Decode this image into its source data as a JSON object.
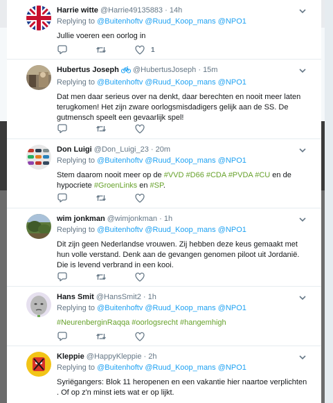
{
  "reply_prefix": "Replying to",
  "tweets": [
    {
      "name": "Harrie witte",
      "handle": "@Harrie49135883",
      "time": "14h",
      "replying_to": [
        "@Buitenhoftv",
        "@Ruud_Koop_mans",
        "@NPO1"
      ],
      "text": "Jullie voeren een oorlog in",
      "like_count": "1",
      "avatar": "union-jack-avatar"
    },
    {
      "name": "Hubertus Joseph",
      "name_suffix_icon": "bicycle-icon",
      "handle": "@HubertusJoseph",
      "time": "15m",
      "replying_to": [
        "@Buitenhoftv",
        "@Ruud_Koop_mans",
        "@NPO1"
      ],
      "text": "Dat men daar serieus over na denkt, daar berechten en nooit meer laten terugkomen! Het zijn zware oorlogsmisdadigers gelijk aan de SS. De gutmensch speelt een gevaarlijk spel!",
      "avatar": "photo-avatar"
    },
    {
      "name": "Don Luigi",
      "handle": "@Don_Luigi_23",
      "time": "20m",
      "replying_to": [
        "@Buitenhoftv",
        "@Ruud_Koop_mans",
        "@NPO1"
      ],
      "text_parts": {
        "a": "Stem daarom nooit meer op de ",
        "t1": "#VVD",
        "t2": "#D66",
        "t3": "#CDA",
        "t4": "#PVDA",
        "t5": "#CU",
        "b": " en de hypocriete ",
        "t6": "#GroenLinks",
        "c": " en ",
        "t7": "#SP",
        "d": "."
      },
      "avatar": "cars-avatar"
    },
    {
      "name": "wim jonkman",
      "handle": "@wimjonkman",
      "time": "1h",
      "replying_to": [
        "@Buitenhoftv",
        "@Ruud_Koop_mans",
        "@NPO1"
      ],
      "text": "Dit zijn geen Nederlandse vrouwen. Zij hebben deze keus gemaakt met hun volle verstand. Denk aan de gevangen genomen piloot uit Jordanië. Die is levend verbrand in een kooi.",
      "avatar": "landscape-avatar"
    },
    {
      "name": "Hans Smit",
      "handle": "@HansSmit2",
      "time": "1h",
      "replying_to": [
        "@Buitenhoftv",
        "@Ruud_Koop_mans",
        "@NPO1"
      ],
      "hashtags": [
        "#NeurenberginRaqqa",
        "#oorlogsrecht",
        "#hangemhigh"
      ],
      "avatar": "meme-face-avatar"
    },
    {
      "name": "Kleppie",
      "handle": "@HappyKleppie",
      "time": "2h",
      "replying_to": [
        "@Buitenhoftv",
        "@Ruud_Koop_mans",
        "@NPO1"
      ],
      "text": "Syriëgangers: Blok 11 heropenen en een vakantie hier naartoe verplichten . Of op z'n minst iets wat er op lijkt.",
      "avatar": "cartoon-avatar"
    }
  ],
  "colors": {
    "link": "#1da1f2",
    "hashtag": "#66a12a",
    "muted": "#657786",
    "text": "#14171a"
  }
}
